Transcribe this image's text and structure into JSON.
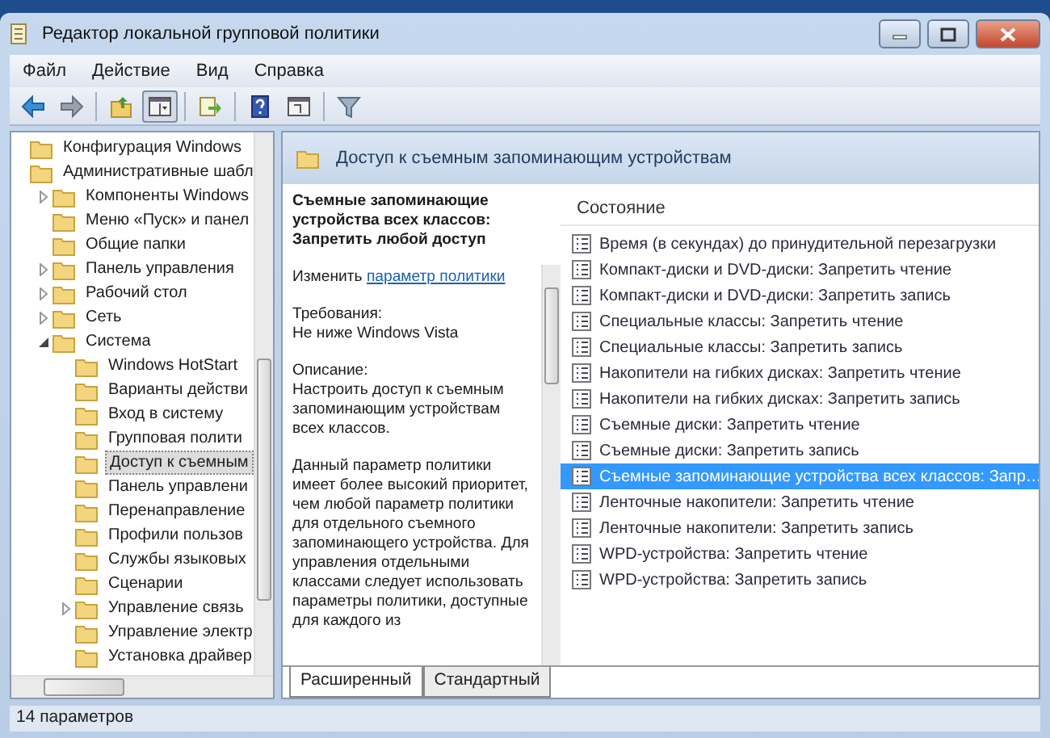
{
  "window": {
    "title": "Редактор локальной групповой политики"
  },
  "menu": [
    "Файл",
    "Действие",
    "Вид",
    "Справка"
  ],
  "toolbar": [
    {
      "kind": "back",
      "pressed": false
    },
    {
      "kind": "forward",
      "pressed": false
    },
    {
      "kind": "separator"
    },
    {
      "kind": "up",
      "pressed": false
    },
    {
      "kind": "tree",
      "pressed": true
    },
    {
      "kind": "separator"
    },
    {
      "kind": "export",
      "pressed": false
    },
    {
      "kind": "separator"
    },
    {
      "kind": "help",
      "pressed": false
    },
    {
      "kind": "panel",
      "pressed": false
    },
    {
      "kind": "separator"
    },
    {
      "kind": "filter",
      "pressed": false
    }
  ],
  "tree": [
    {
      "label": "Конфигурация Windows",
      "selected": false
    },
    {
      "label": "Административные шабл",
      "selected": false,
      "children": [
        {
          "label": "Компоненты Windows",
          "selected": false,
          "expanded": false
        },
        {
          "label": "Меню «Пуск» и панел",
          "selected": false
        },
        {
          "label": "Общие папки",
          "selected": false
        },
        {
          "label": "Панель управления",
          "selected": false,
          "expanded": false
        },
        {
          "label": "Рабочий стол",
          "selected": false,
          "expanded": false
        },
        {
          "label": "Сеть",
          "selected": false,
          "expanded": false
        },
        {
          "label": "Система",
          "selected": false,
          "expanded": true,
          "children": [
            {
              "label": "Windows HotStart",
              "selected": false
            },
            {
              "label": "Варианты действи",
              "selected": false
            },
            {
              "label": "Вход в систему",
              "selected": false
            },
            {
              "label": "Групповая полити",
              "selected": false
            },
            {
              "label": "Доступ к съемным",
              "selected": true
            },
            {
              "label": "Панель управлени",
              "selected": false
            },
            {
              "label": "Перенаправление",
              "selected": false
            },
            {
              "label": "Профили пользов",
              "selected": false
            },
            {
              "label": "Службы языковых",
              "selected": false
            },
            {
              "label": "Сценарии",
              "selected": false
            },
            {
              "label": "Управление связь",
              "selected": false,
              "expanded": false
            },
            {
              "label": "Управление электр",
              "selected": false
            },
            {
              "label": "Установка драйвер",
              "selected": false
            }
          ]
        }
      ]
    }
  ],
  "details": {
    "header": "Доступ к съемным запоминающим устройствам",
    "policy_title": "Съемные запоминающие устройства всех классов: Запретить любой доступ",
    "edit_prefix": "Изменить",
    "edit_link": "параметр политики",
    "requirements_label": "Требования:",
    "requirements": "Не ниже Windows Vista",
    "description_label": "Описание:",
    "description": "Настроить доступ к съемным запоминающим устройствам всех классов.",
    "description_more": "Данный параметр политики имеет более высокий приоритет, чем любой параметр политики для отдельного съемного запоминающего устройства. Для управления отдельными классами следует использовать параметры политики, доступные для каждого из"
  },
  "list": {
    "column": "Состояние",
    "items": [
      {
        "label": "Время (в секундах) до принудительной перезагрузки",
        "selected": false
      },
      {
        "label": "Компакт-диски и DVD-диски: Запретить чтение",
        "selected": false
      },
      {
        "label": "Компакт-диски и DVD-диски: Запретить запись",
        "selected": false
      },
      {
        "label": "Специальные классы: Запретить чтение",
        "selected": false
      },
      {
        "label": "Специальные классы: Запретить запись",
        "selected": false
      },
      {
        "label": "Накопители на гибких дисках: Запретить чтение",
        "selected": false
      },
      {
        "label": "Накопители на гибких дисках: Запретить запись",
        "selected": false
      },
      {
        "label": "Съемные диски: Запретить чтение",
        "selected": false
      },
      {
        "label": "Съемные диски: Запретить запись",
        "selected": false
      },
      {
        "label": "Съемные запоминающие устройства всех классов: Запр…",
        "selected": true
      },
      {
        "label": "Ленточные накопители: Запретить чтение",
        "selected": false
      },
      {
        "label": "Ленточные накопители: Запретить запись",
        "selected": false
      },
      {
        "label": "WPD-устройства: Запретить чтение",
        "selected": false
      },
      {
        "label": "WPD-устройства: Запретить запись",
        "selected": false
      }
    ]
  },
  "tabs": [
    {
      "label": "Расширенный",
      "selected": true
    },
    {
      "label": "Стандартный",
      "selected": false
    }
  ],
  "status_bar": "14 параметров"
}
